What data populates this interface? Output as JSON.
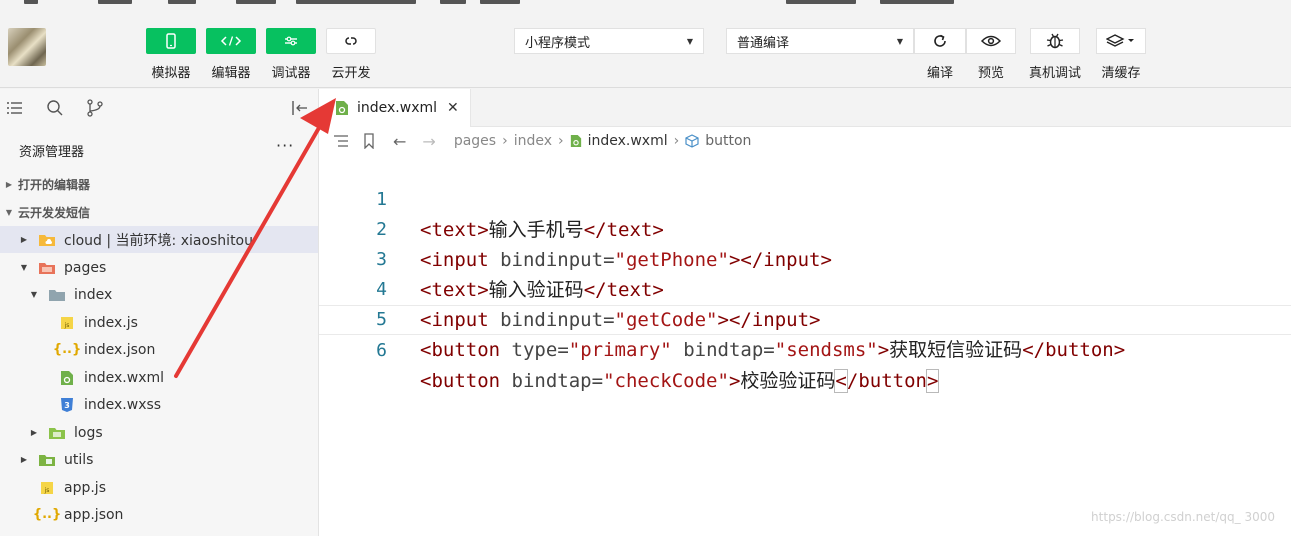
{
  "toolbar": {
    "simulator_label": "模拟器",
    "editor_label": "编辑器",
    "debugger_label": "调试器",
    "cloud_label": "云开发",
    "mode_select": "小程序模式",
    "compile_select": "普通编译",
    "compile_label": "编译",
    "preview_label": "预览",
    "device_debug_label": "真机调试",
    "clear_cache_label": "清缓存",
    "accent": "#07c160"
  },
  "sidebar": {
    "explorer_title": "资源管理器",
    "more": "···",
    "open_editors": "打开的编辑器",
    "project": "云开发发短信",
    "tree": [
      {
        "label": "cloud | 当前环境: xiaoshitou",
        "icon": "folder-cloud-icon"
      },
      {
        "label": "pages",
        "icon": "folder-pages-icon"
      },
      {
        "label": "index",
        "icon": "folder-icon"
      },
      {
        "label": "index.js",
        "icon": "js-file-icon"
      },
      {
        "label": "index.json",
        "icon": "json-file-icon"
      },
      {
        "label": "index.wxml",
        "icon": "wxml-file-icon"
      },
      {
        "label": "index.wxss",
        "icon": "wxss-file-icon"
      },
      {
        "label": "logs",
        "icon": "folder-icon"
      },
      {
        "label": "utils",
        "icon": "folder-icon"
      },
      {
        "label": "app.js",
        "icon": "js-file-icon"
      },
      {
        "label": "app.json",
        "icon": "json-file-icon"
      }
    ]
  },
  "editor": {
    "tab_label": "index.wxml",
    "tab_close": "✕",
    "breadcrumb": [
      "pages",
      "index",
      "index.wxml",
      "button"
    ],
    "line_numbers": [
      "1",
      "2",
      "3",
      "4",
      "5",
      "6"
    ],
    "lines": [
      {
        "tag": "text",
        "text": "输入手机号"
      },
      {
        "tag": "input",
        "attr": "bindinput",
        "value": "getPhone"
      },
      {
        "tag": "text",
        "text": "输入验证码"
      },
      {
        "tag": "input",
        "attr": "bindinput",
        "value": "getCode"
      },
      {
        "tag": "button",
        "attr1": "type",
        "value1": "primary",
        "attr2": "bindtap",
        "value2": "sendsms",
        "text": "获取短信验证码"
      },
      {
        "tag": "button",
        "attr": "bindtap",
        "value": "checkCode",
        "text": "校验验证码"
      }
    ]
  },
  "watermark": "https://blog.csdn.net/qq_    3000"
}
